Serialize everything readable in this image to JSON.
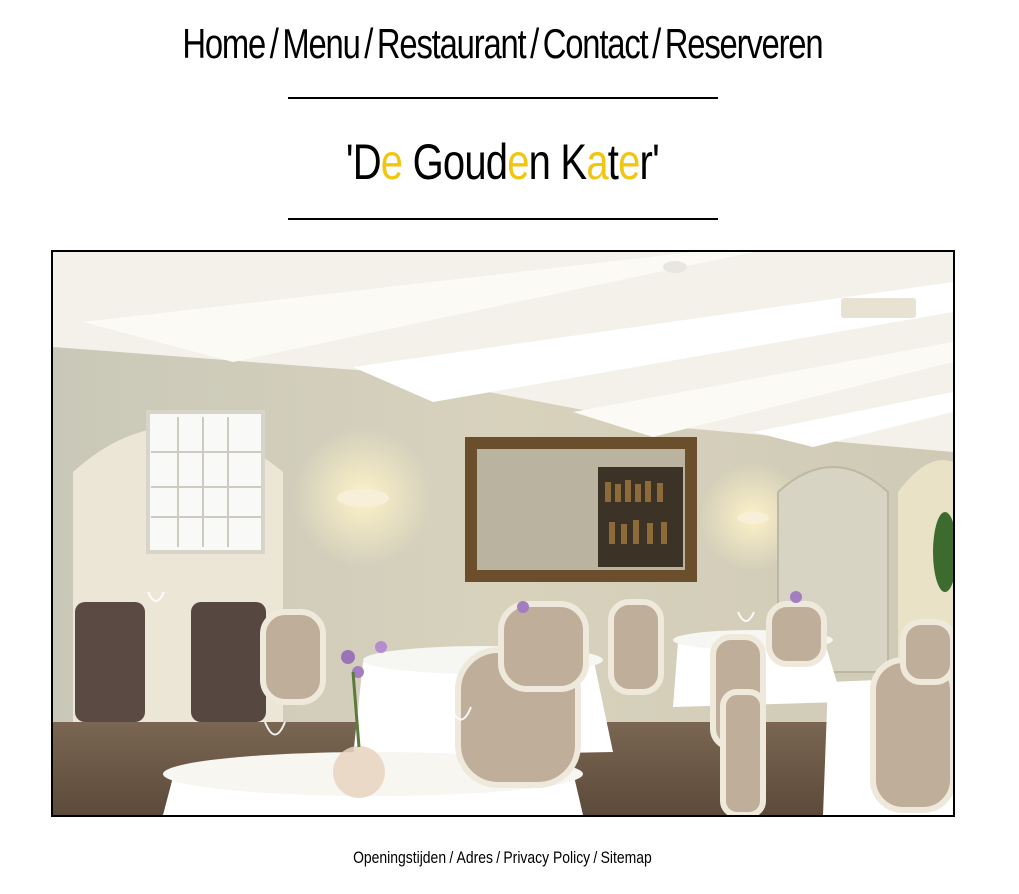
{
  "nav": {
    "items": [
      {
        "label": "Home"
      },
      {
        "label": "Menu"
      },
      {
        "label": "Restaurant"
      },
      {
        "label": "Contact"
      },
      {
        "label": "Reserveren"
      }
    ],
    "separator": "/"
  },
  "title": {
    "parts": [
      "'D",
      "e",
      " Goud",
      "e",
      "n K",
      "a",
      "t",
      "e",
      "r'"
    ],
    "highlight_color": "#f2c511"
  },
  "photo": {
    "subject": "restaurant-dining-room"
  },
  "footer": {
    "items": [
      {
        "label": "Openingstijden"
      },
      {
        "label": "Adres"
      },
      {
        "label": "Privacy Policy"
      },
      {
        "label": "Sitemap"
      }
    ],
    "separator": "/"
  }
}
